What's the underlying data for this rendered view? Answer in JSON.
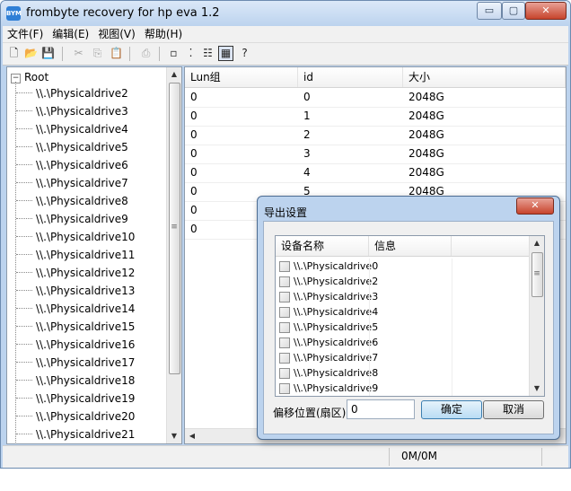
{
  "window": {
    "title": "frombyte recovery for hp eva 1.2",
    "app_icon_text": "BYM",
    "controls": {
      "minimize": "▭",
      "maximize": "▢",
      "close": "✕"
    }
  },
  "menu": [
    "文件(F)",
    "编辑(E)",
    "视图(V)",
    "帮助(H)"
  ],
  "toolbar": [
    {
      "name": "new-file",
      "glyph": "🗋",
      "enabled": true
    },
    {
      "name": "open-folder",
      "glyph": "📂",
      "enabled": true
    },
    {
      "name": "save",
      "glyph": "💾",
      "enabled": true
    },
    {
      "name": "cut",
      "glyph": "✂",
      "enabled": false
    },
    {
      "name": "copy",
      "glyph": "⎘",
      "enabled": false
    },
    {
      "name": "paste",
      "glyph": "📋",
      "enabled": false
    },
    {
      "name": "print",
      "glyph": "⎙",
      "enabled": false
    },
    {
      "name": "large-icons",
      "glyph": "▫",
      "enabled": true
    },
    {
      "name": "small-icons",
      "glyph": "⁚",
      "enabled": true
    },
    {
      "name": "list-view",
      "glyph": "☷",
      "enabled": true
    },
    {
      "name": "details-view",
      "glyph": "▦",
      "enabled": true,
      "active": true
    },
    {
      "name": "help",
      "glyph": "?",
      "enabled": true
    }
  ],
  "tree": {
    "root": "Root",
    "expander": "−",
    "items": [
      "\\\\.\\Physicaldrive2",
      "\\\\.\\Physicaldrive3",
      "\\\\.\\Physicaldrive4",
      "\\\\.\\Physicaldrive5",
      "\\\\.\\Physicaldrive6",
      "\\\\.\\Physicaldrive7",
      "\\\\.\\Physicaldrive8",
      "\\\\.\\Physicaldrive9",
      "\\\\.\\Physicaldrive10",
      "\\\\.\\Physicaldrive11",
      "\\\\.\\Physicaldrive12",
      "\\\\.\\Physicaldrive13",
      "\\\\.\\Physicaldrive14",
      "\\\\.\\Physicaldrive15",
      "\\\\.\\Physicaldrive16",
      "\\\\.\\Physicaldrive17",
      "\\\\.\\Physicaldrive18",
      "\\\\.\\Physicaldrive19",
      "\\\\.\\Physicaldrive20",
      "\\\\.\\Physicaldrive21"
    ],
    "scroll_up": "▲",
    "scroll_down": "▼",
    "scroll_grip": "≡"
  },
  "list": {
    "columns": [
      "Lun组",
      "id",
      "大小"
    ],
    "rows": [
      [
        "0",
        "0",
        "2048G"
      ],
      [
        "0",
        "1",
        "2048G"
      ],
      [
        "0",
        "2",
        "2048G"
      ],
      [
        "0",
        "3",
        "2048G"
      ],
      [
        "0",
        "4",
        "2048G"
      ],
      [
        "0",
        "5",
        "2048G"
      ],
      [
        "0",
        "",
        ""
      ],
      [
        "0",
        "",
        ""
      ]
    ],
    "scroll_left": "◀",
    "scroll_grip": "⦙"
  },
  "status": {
    "text": "0M/0M"
  },
  "dialog": {
    "title": "导出设置",
    "close": "✕",
    "columns": [
      "设备名称",
      "信息"
    ],
    "items": [
      "\\\\.\\Physicaldrive0",
      "\\\\.\\Physicaldrive2",
      "\\\\.\\Physicaldrive3",
      "\\\\.\\Physicaldrive4",
      "\\\\.\\Physicaldrive5",
      "\\\\.\\Physicaldrive6",
      "\\\\.\\Physicaldrive7",
      "\\\\.\\Physicaldrive8",
      "\\\\.\\Physicaldrive9"
    ],
    "offset_label": "偏移位置(扇区)",
    "offset_value": "0",
    "ok_label": "确定",
    "cancel_label": "取消",
    "scroll_up": "▲",
    "scroll_down": "▼",
    "scroll_grip": "≡"
  }
}
